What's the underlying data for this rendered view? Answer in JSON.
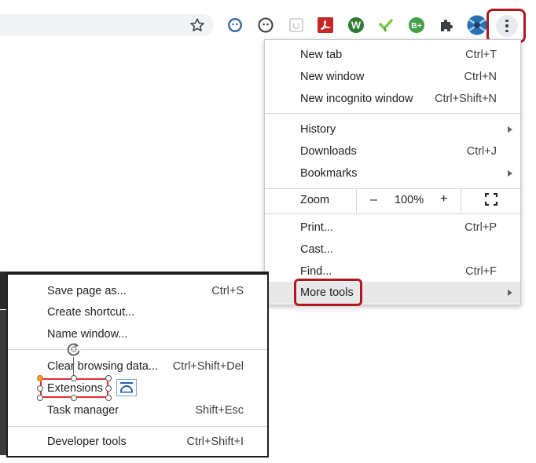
{
  "toolbar": {
    "extensions": [
      {
        "icon": "ghost-face-icon",
        "color": "#3c6e9e"
      },
      {
        "icon": "ghost-face-outline-icon",
        "color": "#3c4043"
      },
      {
        "icon": "square-face-icon",
        "color": "#c8c8c8"
      },
      {
        "icon": "pdf-icon",
        "color": "#c62828"
      },
      {
        "icon": "w-circle-icon",
        "color": "#2e7d32"
      },
      {
        "icon": "check-icon",
        "color": "#7ac943"
      },
      {
        "icon": "b-plus-icon",
        "color": "#43a047"
      },
      {
        "icon": "puzzle-icon",
        "color": "#3c4043"
      },
      {
        "icon": "avatar-icon",
        "color": "#2a6fb0"
      }
    ]
  },
  "menu": {
    "new_tab": {
      "label": "New tab",
      "shortcut": "Ctrl+T"
    },
    "new_window": {
      "label": "New window",
      "shortcut": "Ctrl+N"
    },
    "new_incognito": {
      "label": "New incognito window",
      "shortcut": "Ctrl+Shift+N"
    },
    "history": {
      "label": "History"
    },
    "downloads": {
      "label": "Downloads",
      "shortcut": "Ctrl+J"
    },
    "bookmarks": {
      "label": "Bookmarks"
    },
    "zoom": {
      "label": "Zoom",
      "minus": "–",
      "value": "100%",
      "plus": "+"
    },
    "print": {
      "label": "Print...",
      "shortcut": "Ctrl+P"
    },
    "cast": {
      "label": "Cast..."
    },
    "find": {
      "label": "Find...",
      "shortcut": "Ctrl+F"
    },
    "more_tools": {
      "label": "More tools"
    }
  },
  "submenu": {
    "save_page": {
      "label": "Save page as...",
      "shortcut": "Ctrl+S"
    },
    "create_shortcut": {
      "label": "Create shortcut..."
    },
    "name_window": {
      "label": "Name window..."
    },
    "clear_browsing": {
      "label": "Clear browsing data...",
      "shortcut": "Ctrl+Shift+Del"
    },
    "extensions": {
      "label": "Extensions"
    },
    "task_manager": {
      "label": "Task manager",
      "shortcut": "Shift+Esc"
    },
    "developer_tools": {
      "label": "Developer tools",
      "shortcut": "Ctrl+Shift+I"
    }
  },
  "colors": {
    "highlight": "#b0171f",
    "hover": "#e8e8e8"
  }
}
